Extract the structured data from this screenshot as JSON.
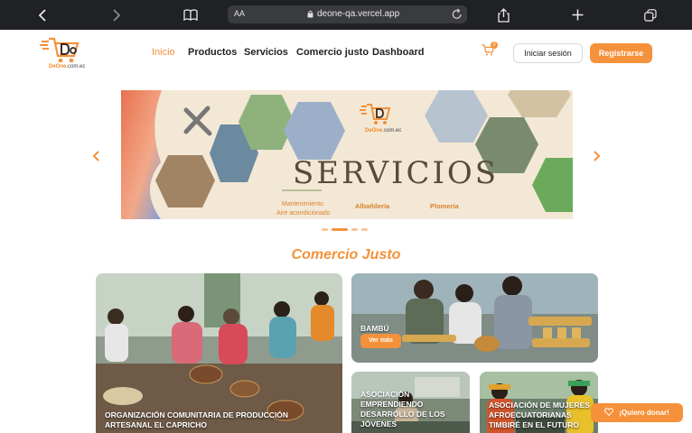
{
  "browser": {
    "aa_label": "AA",
    "url": "deone-qa.vercel.app"
  },
  "header": {
    "logo_text": "DeOne",
    "logo_suffix": ".com.ec",
    "nav": [
      {
        "label": "Inicio",
        "active": true
      },
      {
        "label": "Productos"
      },
      {
        "label": "Servicios"
      },
      {
        "label": "Comercio justo"
      },
      {
        "label": "Dashboard"
      }
    ],
    "cart_count": "0",
    "login_label": "Iniciar sesión",
    "register_label": "Registrarse"
  },
  "banner": {
    "logo_text": "DeOne",
    "logo_suffix": ".com.ec",
    "title": "SERVICIOS",
    "services": [
      "Mantenimiento",
      "Aire acondicionado",
      "Albañilería",
      "Plomería"
    ],
    "slide_index": 1,
    "slide_count": 4
  },
  "section": {
    "title": "Comercio Justo"
  },
  "cards": [
    {
      "title": "Organización comunitaria de producción artesanal El Capricho"
    },
    {
      "title": "Bambú",
      "cta": "Ver más"
    },
    {
      "title": "Asociación emprendiendo desarrollo de los jóvenes"
    },
    {
      "title": "Asociación de mujeres afroecuatorianas Timbiré en el futuro"
    }
  ],
  "donate": {
    "label": "¡Quiero donar!"
  },
  "colors": {
    "accent": "#f5913a",
    "browser_bar": "#1f2125"
  }
}
